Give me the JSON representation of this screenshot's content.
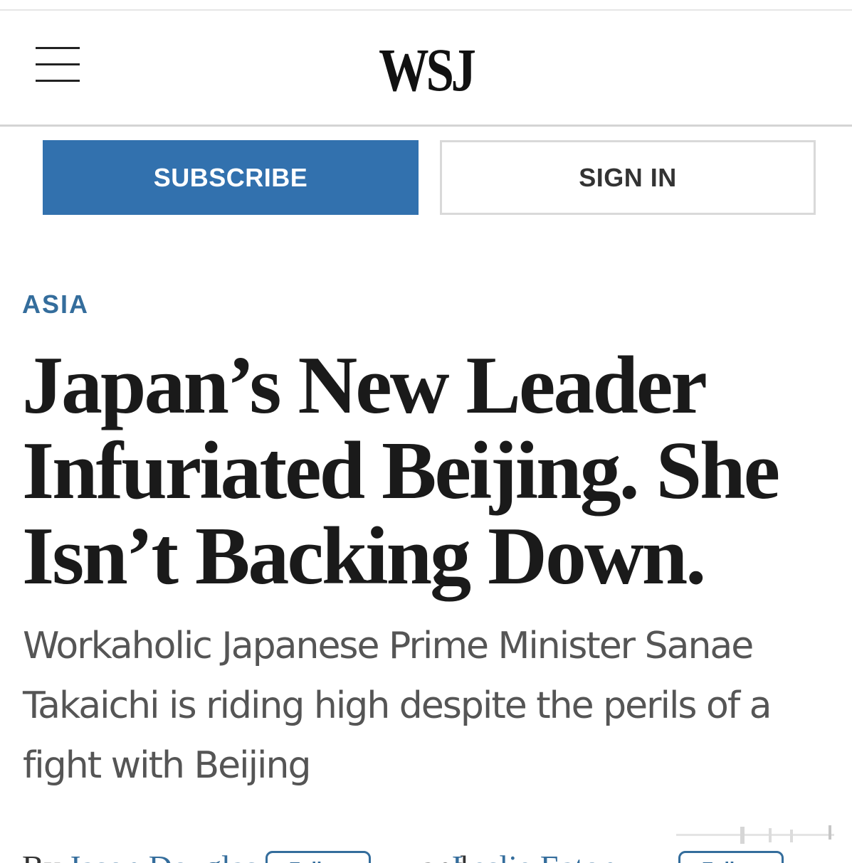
{
  "header": {
    "logo": "WSJ",
    "menu_icon": "hamburger-menu-icon"
  },
  "actions": {
    "subscribe_label": "SUBSCRIBE",
    "signin_label": "SIGN IN"
  },
  "article": {
    "section": "ASIA",
    "headline": "Japan’s New Leader Infuriated Beijing. She Isn’t Backing Down.",
    "dek": "Workaholic Japanese Prime Minister Sanae Takaichi is riding high despite the perils of a fight with Beijing",
    "byline": {
      "by": "By",
      "author_1": "Jason Douglas",
      "and": "and",
      "author_2": "Leslie Eaton",
      "follow_label": "Follow"
    }
  },
  "colors": {
    "accent": "#3271ae",
    "section": "#346d9c",
    "text": "#1a1a1a",
    "dek": "#555555"
  }
}
